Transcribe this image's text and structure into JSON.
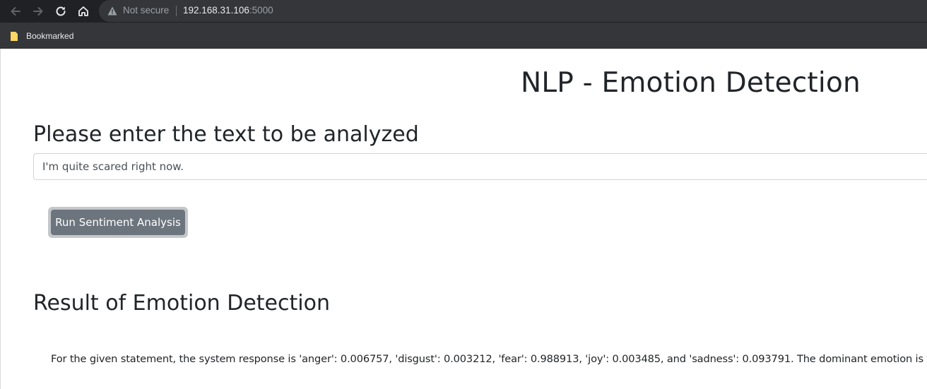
{
  "browser": {
    "security_label": "Not secure",
    "url_host": "192.168.31.106",
    "url_port": ":5000",
    "bookmark_label": "Bookmarked"
  },
  "icons": {
    "back": "back-arrow-icon",
    "forward": "forward-arrow-icon",
    "reload": "reload-icon",
    "home": "home-icon",
    "warning": "warning-triangle-icon",
    "bookmark": "bookmark-folder-icon"
  },
  "page": {
    "title": "NLP - Emotion Detection",
    "prompt_heading": "Please enter the text to be analyzed",
    "input_value": "I'm quite scared right now.",
    "run_button_label": "Run Sentiment Analysis",
    "result_heading": "Result of Emotion Detection",
    "result_text": "For the given statement, the system response is 'anger': 0.006757, 'disgust': 0.003212, 'fear': 0.988913, 'joy': 0.003485, and 'sadness': 0.093791. The dominant emotion is fear."
  },
  "colors": {
    "button_bg": "#6c757d",
    "text": "#212529",
    "chrome_dark": "#202124",
    "chrome_bar": "#35363a"
  }
}
